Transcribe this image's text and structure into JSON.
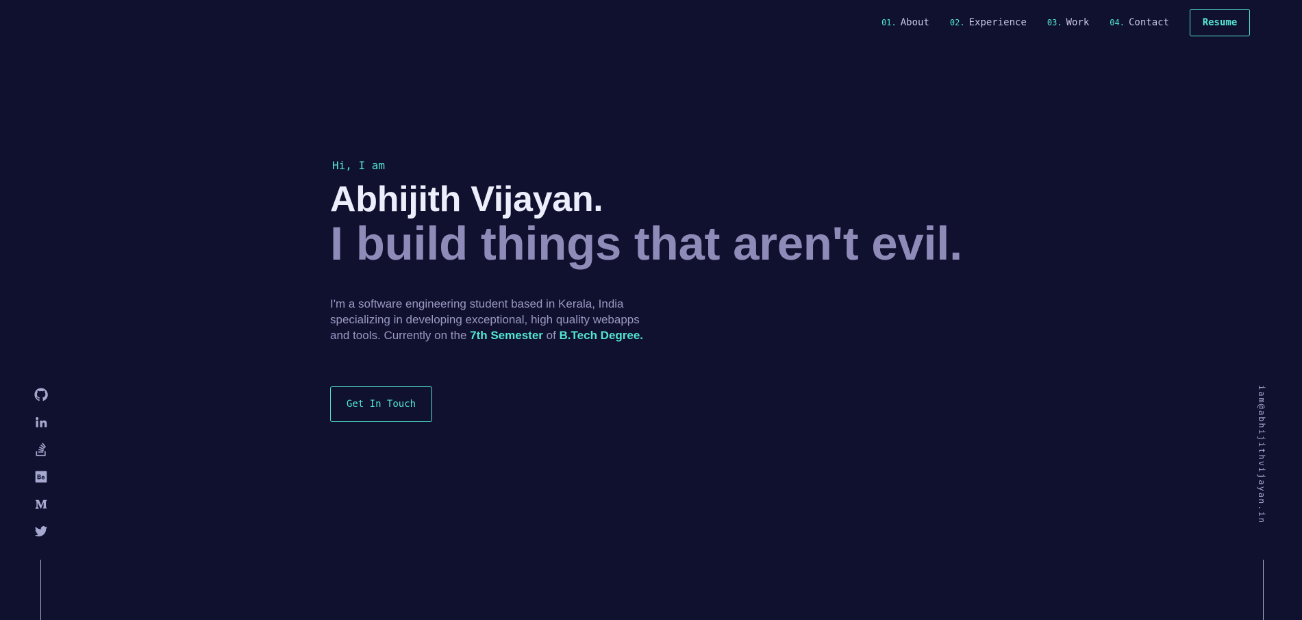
{
  "nav": {
    "items": [
      {
        "num": "01.",
        "label": "About"
      },
      {
        "num": "02.",
        "label": "Experience"
      },
      {
        "num": "03.",
        "label": "Work"
      },
      {
        "num": "04.",
        "label": "Contact"
      }
    ],
    "resume_label": "Resume"
  },
  "hero": {
    "greeting": "Hi, I am",
    "name": "Abhijith Vijayan.",
    "tagline": "I build things that aren't evil.",
    "bio": {
      "text_1": "I'm a software engineering student based in Kerala, India specializing in developing exceptional, high quality webapps and tools. Currently on the ",
      "highlight_1": "7th Semester",
      "text_2": " of ",
      "highlight_2": "B.Tech Degree."
    },
    "cta_label": "Get In Touch"
  },
  "social": {
    "icons": [
      "github-icon",
      "linkedin-icon",
      "stackoverflow-icon",
      "behance-icon",
      "medium-icon",
      "twitter-icon"
    ]
  },
  "email": "iam@abhijithvijayan.in",
  "colors": {
    "background": "#10102f",
    "accent": "#52e6d2",
    "heading": "#eceefb",
    "subheading": "#8e8bb8",
    "text": "#9a98c2",
    "muted": "#a6a8cf"
  }
}
